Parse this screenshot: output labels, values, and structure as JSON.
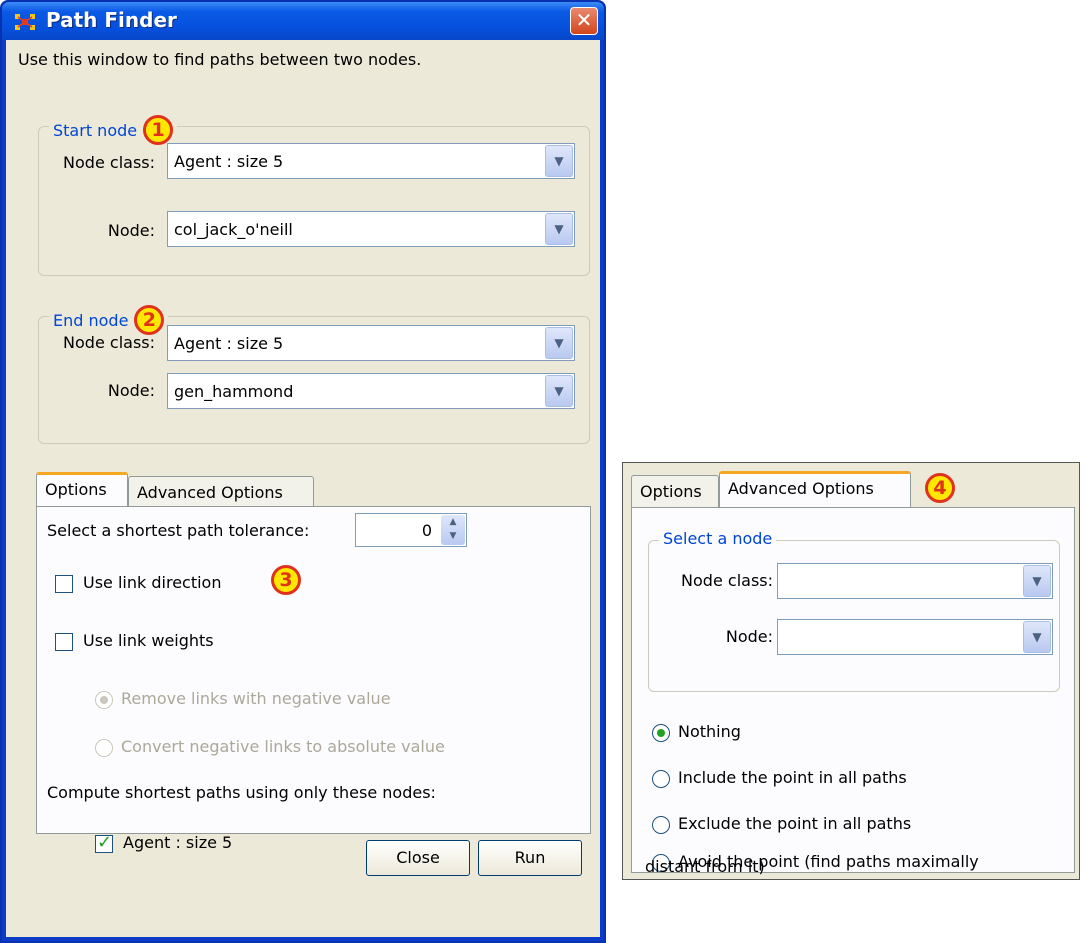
{
  "window": {
    "title": "Path Finder",
    "close_glyph": "✕",
    "intro": "Use this window to find paths between two nodes."
  },
  "start_node": {
    "legend": "Start node",
    "badge": "1",
    "node_class_label": "Node class:",
    "node_class_value": "Agent : size 5",
    "node_label": "Node:",
    "node_value": "col_jack_o'neill"
  },
  "end_node": {
    "legend": "End node",
    "badge": "2",
    "node_class_label": "Node class:",
    "node_class_value": "Agent : size 5",
    "node_label": "Node:",
    "node_value": "gen_hammond"
  },
  "tabs": [
    {
      "label": "Options",
      "active": true
    },
    {
      "label": "Advanced Options",
      "active": false
    }
  ],
  "options": {
    "tolerance_label": "Select a shortest path tolerance:",
    "tolerance_value": "0",
    "badge": "3",
    "use_link_direction": "Use link direction",
    "use_link_weights": "Use link weights",
    "remove_negative": "Remove links with negative value",
    "convert_negative": "Convert negative links to absolute value",
    "compute_label": "Compute shortest paths using only these nodes:",
    "node_agent": "Agent : size 5"
  },
  "buttons": {
    "close": "Close",
    "run": "Run"
  },
  "advanced_panel": {
    "tabs": [
      {
        "label": "Options",
        "active": false
      },
      {
        "label": "Advanced Options",
        "active": true
      }
    ],
    "badge": "4",
    "legend": "Select a node",
    "node_class_label": "Node class:",
    "node_class_value": "",
    "node_label": "Node:",
    "node_value": "",
    "radio_nothing": "Nothing",
    "radio_include": "Include the point in all paths",
    "radio_exclude": "Exclude the point in all paths",
    "radio_avoid_line1": "Avoid the point (find paths maximally",
    "radio_avoid_line2": "distant from it)"
  },
  "icons": {
    "app": "path-finder-app-icon",
    "close": "close-icon",
    "dropdown": "chevron-down-icon",
    "spinner": "spinner-arrows-icon"
  },
  "colors": {
    "titlebar": "#0a5ae6",
    "window_bg": "#ece9d8",
    "legend_text": "#0046d5",
    "badge_fill": "#ffe800",
    "badge_border": "#e0311a",
    "tab_active_accent": "#f5a623",
    "check_green": "#21a121"
  }
}
